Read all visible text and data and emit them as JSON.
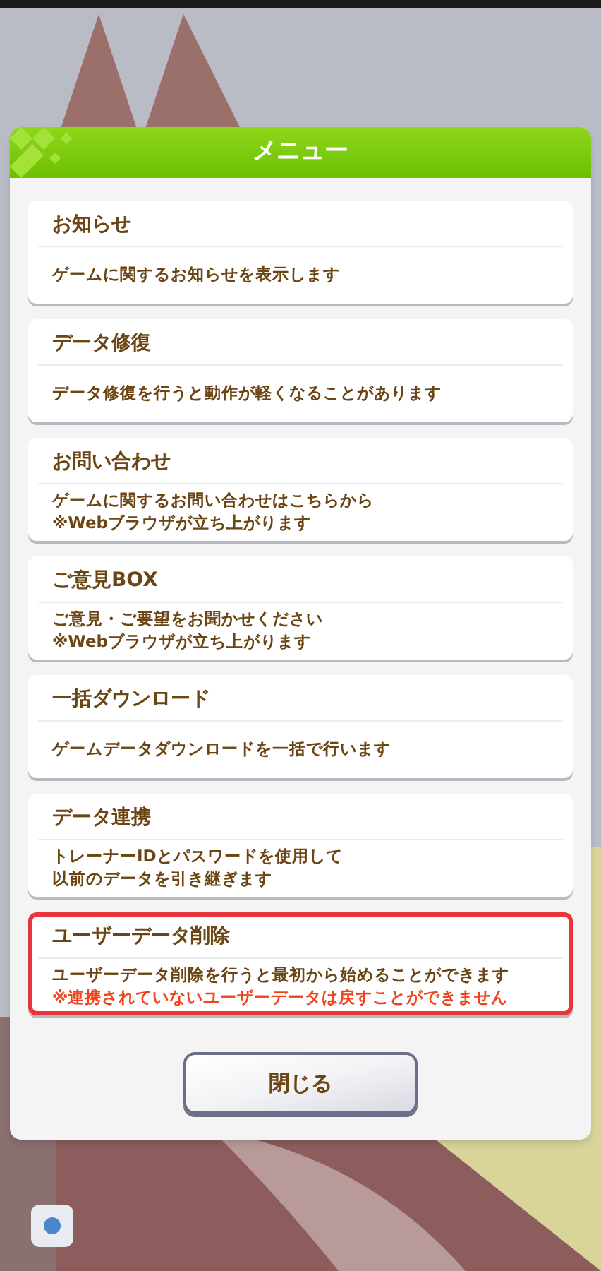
{
  "dialog": {
    "title": "メニュー",
    "items": [
      {
        "title": "お知らせ",
        "highlighted": false,
        "lines": [
          {
            "kind": "normal",
            "text": "ゲームに関するお知らせを表示します"
          }
        ]
      },
      {
        "title": "データ修復",
        "highlighted": false,
        "lines": [
          {
            "kind": "normal",
            "text": "データ修復を行うと動作が軽くなることがあります"
          }
        ]
      },
      {
        "title": "お問い合わせ",
        "highlighted": false,
        "lines": [
          {
            "kind": "normal",
            "text": "ゲームに関するお問い合わせはこちらから"
          },
          {
            "kind": "normal",
            "text": "※Webブラウザが立ち上がります"
          }
        ]
      },
      {
        "title": "ご意見BOX",
        "highlighted": false,
        "lines": [
          {
            "kind": "normal",
            "text": "ご意見・ご要望をお聞かせください"
          },
          {
            "kind": "normal",
            "text": "※Webブラウザが立ち上がります"
          }
        ]
      },
      {
        "title": "一括ダウンロード",
        "highlighted": false,
        "lines": [
          {
            "kind": "normal",
            "text": "ゲームデータダウンロードを一括で行います"
          }
        ]
      },
      {
        "title": "データ連携",
        "highlighted": false,
        "lines": [
          {
            "kind": "normal",
            "text": "トレーナーIDとパスワードを使用して"
          },
          {
            "kind": "normal",
            "text": "以前のデータを引き継ぎます"
          }
        ]
      },
      {
        "title": "ユーザーデータ削除",
        "highlighted": true,
        "lines": [
          {
            "kind": "normal",
            "text": "ユーザーデータ削除を行うと最初から始めることができます"
          },
          {
            "kind": "warning",
            "text": "※連携されていないユーザーデータは戻すことができません"
          }
        ]
      }
    ],
    "close_button": "閉じる"
  }
}
